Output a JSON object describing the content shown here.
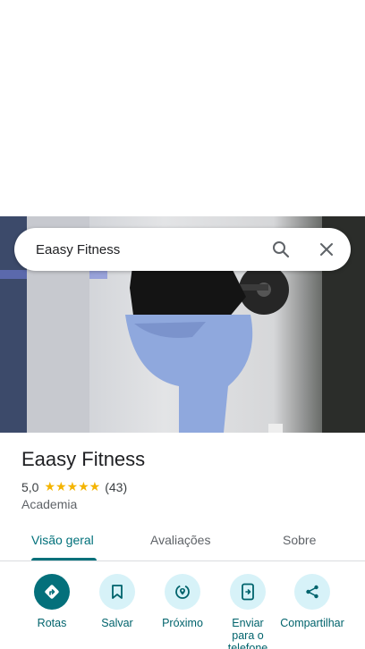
{
  "search": {
    "query": "Eaasy Fitness"
  },
  "place": {
    "name": "Eaasy Fitness",
    "rating": "5,0",
    "stars": "★★★★★",
    "review_count": "(43)",
    "category": "Academia"
  },
  "tabs": [
    {
      "label": "Visão geral",
      "active": true
    },
    {
      "label": "Avaliações",
      "active": false
    },
    {
      "label": "Sobre",
      "active": false
    }
  ],
  "actions": [
    {
      "label": "Rotas",
      "icon": "directions-icon"
    },
    {
      "label": "Salvar",
      "icon": "bookmark-icon"
    },
    {
      "label": "Próximo",
      "icon": "nearby-icon"
    },
    {
      "label": "Enviar para o telefone",
      "icon": "send-to-phone-icon"
    },
    {
      "label": "Compartilhar",
      "icon": "share-icon"
    }
  ],
  "colors": {
    "accent": "#00707a",
    "chip_bg": "#d7f2f8",
    "star": "#f4b400"
  }
}
